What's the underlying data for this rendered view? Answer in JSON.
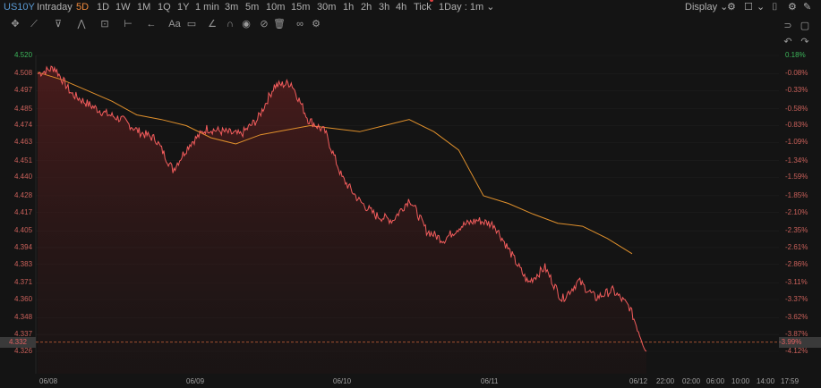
{
  "header": {
    "symbol": "US10Y",
    "timeframes": [
      "Intraday",
      "5D",
      "1D",
      "1W",
      "1M",
      "1Q",
      "1Y",
      "1 min",
      "3m",
      "5m",
      "10m",
      "15m",
      "30m",
      "1h",
      "2h",
      "3h",
      "4h",
      "Tick"
    ],
    "active_timeframe": "5D",
    "interval": "1Day : 1m",
    "display_label": "Display"
  },
  "toolbar": {
    "icons": [
      "move-icon",
      "line-tool-icon",
      "fib-tool-icon",
      "pattern-tool-icon",
      "measure-tool-icon",
      "range-tool-icon",
      "arrow-tool-icon",
      "text-tool-icon",
      "brush-icon",
      "magnet-icon",
      "eye-icon",
      "hide-icon",
      "trash-icon",
      "link-icon",
      "settings-icon"
    ],
    "text_tool": "Aa"
  },
  "colors": {
    "background": "#141414",
    "price_line": "#f25c5c",
    "ma_line": "#e0902c",
    "up": "#3cb55a",
    "down": "#c9605a"
  },
  "axis": {
    "y_left": [
      "4.520",
      "4.508",
      "4.497",
      "4.485",
      "4.474",
      "4.463",
      "4.451",
      "4.440",
      "4.428",
      "4.417",
      "4.405",
      "4.394",
      "4.383",
      "4.371",
      "4.360",
      "4.348",
      "4.337",
      "4.332",
      "4.326"
    ],
    "y_right": [
      "0.18%",
      "-0.08%",
      "-0.33%",
      "-0.58%",
      "-0.83%",
      "-1.09%",
      "-1.34%",
      "-1.59%",
      "-1.85%",
      "-2.10%",
      "-2.35%",
      "-2.61%",
      "-2.86%",
      "-3.11%",
      "-3.37%",
      "-3.62%",
      "-3.87%",
      "-3.99%",
      "-4.12%"
    ],
    "x": [
      "06/08",
      "06/09",
      "06/10",
      "06/11",
      "06/12",
      "22:00",
      "02:00",
      "06:00",
      "10:00",
      "14:00",
      "17:59"
    ],
    "current_price": "4.332",
    "current_pct": "-3.99%"
  },
  "chart_data": {
    "type": "line",
    "x": [
      "06/08",
      "06/09",
      "06/10",
      "06/11",
      "06/12"
    ],
    "ylim": [
      4.326,
      4.52
    ],
    "series": [
      {
        "values": [
          4.508,
          4.512,
          4.495,
          4.488,
          4.482,
          4.478,
          4.47,
          4.465,
          4.445,
          4.462,
          4.472,
          4.47,
          4.468,
          4.478,
          4.5,
          4.502,
          4.478,
          4.47,
          4.44,
          4.425,
          4.415,
          4.412,
          4.426,
          4.405,
          4.399,
          4.408,
          4.412,
          4.409,
          4.39,
          4.371,
          4.381,
          4.36,
          4.372,
          4.361,
          4.366,
          4.355,
          4.326
        ]
      },
      {
        "values": [
          4.509,
          4.504,
          4.497,
          4.49,
          4.481,
          4.478,
          4.474,
          4.466,
          4.462,
          4.468,
          4.471,
          4.474,
          4.472,
          4.47,
          4.474,
          4.478,
          4.47,
          4.458,
          4.428,
          4.423,
          4.416,
          4.41,
          4.408,
          4.4,
          4.39
        ]
      }
    ]
  }
}
